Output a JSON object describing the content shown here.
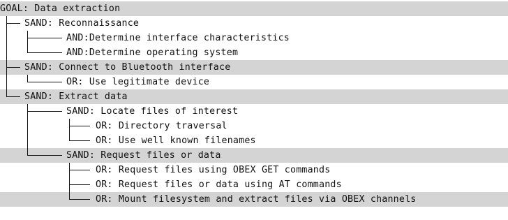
{
  "tree": {
    "rows": [
      {
        "text": "GOAL: Data extraction",
        "depth": 0,
        "last": true,
        "shaded": true
      },
      {
        "text": "SAND: Reconnaissance",
        "depth": 1,
        "last": false,
        "shaded": false
      },
      {
        "text": "AND:Determine interface characteristics",
        "depth": 2,
        "last": false,
        "shaded": false
      },
      {
        "text": "AND:Determine operating system",
        "depth": 2,
        "last": true,
        "shaded": false
      },
      {
        "text": "SAND: Connect to Bluetooth interface",
        "depth": 1,
        "last": false,
        "shaded": true
      },
      {
        "text": "OR: Use legitimate device",
        "depth": 2,
        "last": true,
        "shaded": false
      },
      {
        "text": "SAND: Extract data",
        "depth": 1,
        "last": true,
        "shaded": true
      },
      {
        "text": "SAND: Locate files of interest",
        "depth": 2,
        "last": false,
        "shaded": false
      },
      {
        "text": "OR: Directory traversal",
        "depth": 3,
        "last": false,
        "shaded": false
      },
      {
        "text": "OR: Use well known filenames",
        "depth": 3,
        "last": true,
        "shaded": false
      },
      {
        "text": "SAND: Request files or data",
        "depth": 2,
        "last": true,
        "shaded": true
      },
      {
        "text": "OR: Request files using OBEX GET commands",
        "depth": 3,
        "last": false,
        "shaded": false
      },
      {
        "text": "OR: Request files or data using AT commands",
        "depth": 3,
        "last": false,
        "shaded": false
      },
      {
        "text": "OR: Mount filesystem and extract files via OBEX channels",
        "depth": 3,
        "last": true,
        "shaded": true
      }
    ]
  }
}
